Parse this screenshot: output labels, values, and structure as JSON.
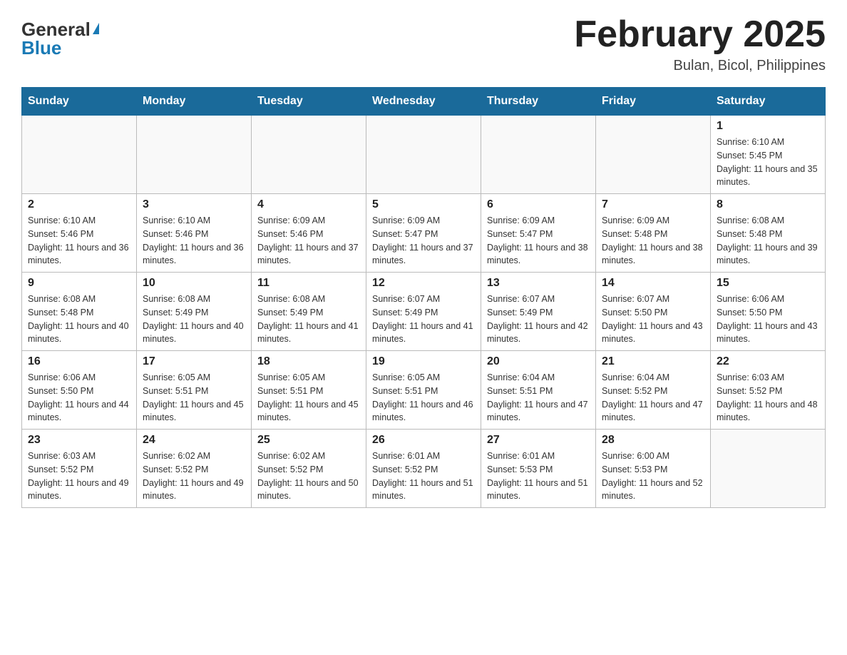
{
  "header": {
    "logo_general": "General",
    "logo_blue": "Blue",
    "month_title": "February 2025",
    "location": "Bulan, Bicol, Philippines"
  },
  "weekdays": [
    "Sunday",
    "Monday",
    "Tuesday",
    "Wednesday",
    "Thursday",
    "Friday",
    "Saturday"
  ],
  "weeks": [
    [
      {
        "day": "",
        "info": ""
      },
      {
        "day": "",
        "info": ""
      },
      {
        "day": "",
        "info": ""
      },
      {
        "day": "",
        "info": ""
      },
      {
        "day": "",
        "info": ""
      },
      {
        "day": "",
        "info": ""
      },
      {
        "day": "1",
        "info": "Sunrise: 6:10 AM\nSunset: 5:45 PM\nDaylight: 11 hours and 35 minutes."
      }
    ],
    [
      {
        "day": "2",
        "info": "Sunrise: 6:10 AM\nSunset: 5:46 PM\nDaylight: 11 hours and 36 minutes."
      },
      {
        "day": "3",
        "info": "Sunrise: 6:10 AM\nSunset: 5:46 PM\nDaylight: 11 hours and 36 minutes."
      },
      {
        "day": "4",
        "info": "Sunrise: 6:09 AM\nSunset: 5:46 PM\nDaylight: 11 hours and 37 minutes."
      },
      {
        "day": "5",
        "info": "Sunrise: 6:09 AM\nSunset: 5:47 PM\nDaylight: 11 hours and 37 minutes."
      },
      {
        "day": "6",
        "info": "Sunrise: 6:09 AM\nSunset: 5:47 PM\nDaylight: 11 hours and 38 minutes."
      },
      {
        "day": "7",
        "info": "Sunrise: 6:09 AM\nSunset: 5:48 PM\nDaylight: 11 hours and 38 minutes."
      },
      {
        "day": "8",
        "info": "Sunrise: 6:08 AM\nSunset: 5:48 PM\nDaylight: 11 hours and 39 minutes."
      }
    ],
    [
      {
        "day": "9",
        "info": "Sunrise: 6:08 AM\nSunset: 5:48 PM\nDaylight: 11 hours and 40 minutes."
      },
      {
        "day": "10",
        "info": "Sunrise: 6:08 AM\nSunset: 5:49 PM\nDaylight: 11 hours and 40 minutes."
      },
      {
        "day": "11",
        "info": "Sunrise: 6:08 AM\nSunset: 5:49 PM\nDaylight: 11 hours and 41 minutes."
      },
      {
        "day": "12",
        "info": "Sunrise: 6:07 AM\nSunset: 5:49 PM\nDaylight: 11 hours and 41 minutes."
      },
      {
        "day": "13",
        "info": "Sunrise: 6:07 AM\nSunset: 5:49 PM\nDaylight: 11 hours and 42 minutes."
      },
      {
        "day": "14",
        "info": "Sunrise: 6:07 AM\nSunset: 5:50 PM\nDaylight: 11 hours and 43 minutes."
      },
      {
        "day": "15",
        "info": "Sunrise: 6:06 AM\nSunset: 5:50 PM\nDaylight: 11 hours and 43 minutes."
      }
    ],
    [
      {
        "day": "16",
        "info": "Sunrise: 6:06 AM\nSunset: 5:50 PM\nDaylight: 11 hours and 44 minutes."
      },
      {
        "day": "17",
        "info": "Sunrise: 6:05 AM\nSunset: 5:51 PM\nDaylight: 11 hours and 45 minutes."
      },
      {
        "day": "18",
        "info": "Sunrise: 6:05 AM\nSunset: 5:51 PM\nDaylight: 11 hours and 45 minutes."
      },
      {
        "day": "19",
        "info": "Sunrise: 6:05 AM\nSunset: 5:51 PM\nDaylight: 11 hours and 46 minutes."
      },
      {
        "day": "20",
        "info": "Sunrise: 6:04 AM\nSunset: 5:51 PM\nDaylight: 11 hours and 47 minutes."
      },
      {
        "day": "21",
        "info": "Sunrise: 6:04 AM\nSunset: 5:52 PM\nDaylight: 11 hours and 47 minutes."
      },
      {
        "day": "22",
        "info": "Sunrise: 6:03 AM\nSunset: 5:52 PM\nDaylight: 11 hours and 48 minutes."
      }
    ],
    [
      {
        "day": "23",
        "info": "Sunrise: 6:03 AM\nSunset: 5:52 PM\nDaylight: 11 hours and 49 minutes."
      },
      {
        "day": "24",
        "info": "Sunrise: 6:02 AM\nSunset: 5:52 PM\nDaylight: 11 hours and 49 minutes."
      },
      {
        "day": "25",
        "info": "Sunrise: 6:02 AM\nSunset: 5:52 PM\nDaylight: 11 hours and 50 minutes."
      },
      {
        "day": "26",
        "info": "Sunrise: 6:01 AM\nSunset: 5:52 PM\nDaylight: 11 hours and 51 minutes."
      },
      {
        "day": "27",
        "info": "Sunrise: 6:01 AM\nSunset: 5:53 PM\nDaylight: 11 hours and 51 minutes."
      },
      {
        "day": "28",
        "info": "Sunrise: 6:00 AM\nSunset: 5:53 PM\nDaylight: 11 hours and 52 minutes."
      },
      {
        "day": "",
        "info": ""
      }
    ]
  ]
}
